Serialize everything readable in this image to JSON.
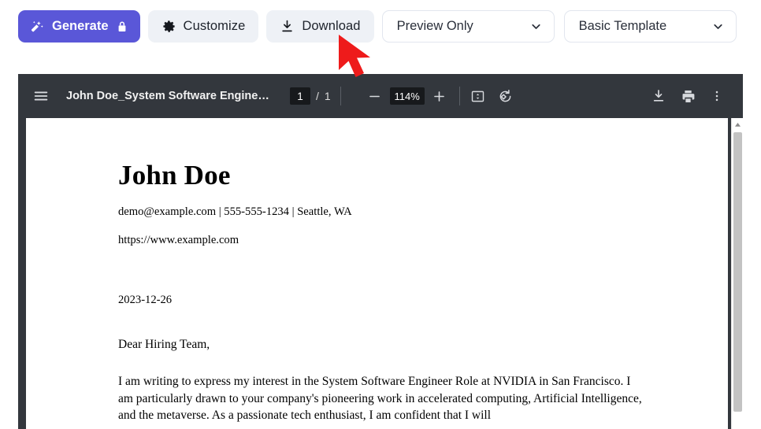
{
  "toolbar": {
    "generate_label": "Generate",
    "generate_icon": "magic-wand-icon",
    "generate_lock_icon": "lock-icon",
    "generate_color": "#5a57d8",
    "customize_label": "Customize",
    "customize_icon": "gear-icon",
    "download_label": "Download",
    "download_icon": "download-icon",
    "preview_mode_value": "Preview Only",
    "template_value": "Basic Template",
    "dropdown_icon": "chevron-down-icon"
  },
  "pdf_viewer": {
    "menu_icon": "hamburger-menu-icon",
    "document_title": "John Doe_System Software Engineer...",
    "current_page": "1",
    "page_separator": "/",
    "total_pages": "1",
    "zoom_out_icon": "minus-icon",
    "zoom_level": "114%",
    "zoom_in_icon": "plus-icon",
    "fit_page_icon": "fit-to-page-icon",
    "rotate_icon": "rotate-counterclockwise-icon",
    "download_icon": "download-icon",
    "print_icon": "print-icon",
    "more_icon": "more-vertical-icon",
    "scrollbar_up_icon": "scroll-up-arrow-icon",
    "toolbar_color": "#33373d"
  },
  "document": {
    "name": "John Doe",
    "contact": "demo@example.com  | 555-555-1234  | Seattle, WA",
    "website": "https://www.example.com",
    "date": "2023-12-26",
    "greeting": "Dear Hiring Team,",
    "body": "I am writing to express my interest in the System Software Engineer Role at NVIDIA in San Francisco. I am particularly drawn to your company's pioneering work in accelerated computing, Artificial Intelligence, and the metaverse. As a passionate tech enthusiast, I am confident that I will"
  },
  "annotation": {
    "cursor_icon": "red-arrow-cursor",
    "cursor_color": "#ee1b1b"
  }
}
